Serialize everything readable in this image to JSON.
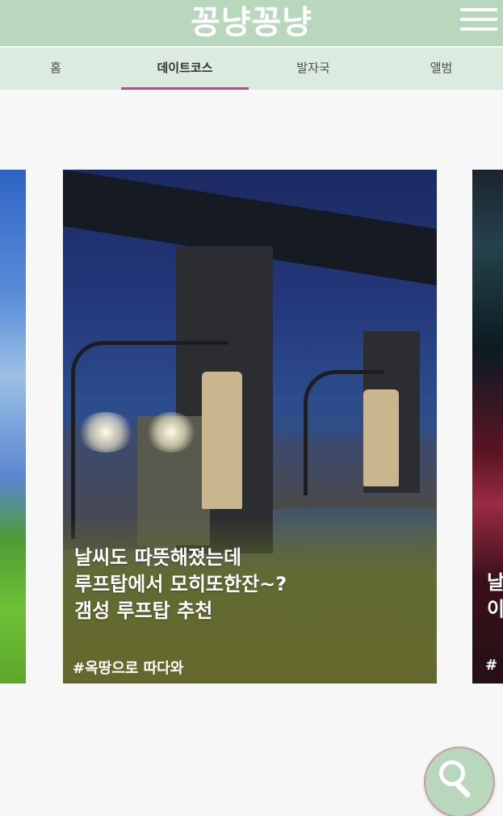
{
  "header": {
    "logo": "꽁냥꽁냥",
    "menu_icon": "hamburger-menu-icon",
    "background": "#b9d7bd"
  },
  "tabs": [
    {
      "label": "홈",
      "active": false
    },
    {
      "label": "데이트코스",
      "active": true
    },
    {
      "label": "발자국",
      "active": false
    },
    {
      "label": "앨범",
      "active": false
    }
  ],
  "accent_color": "#a8577a",
  "carousel": {
    "main_card": {
      "title_lines": [
        "날씨도 따뜻해졌는데",
        "루프탑에서 모히또한잔~?",
        "갬성 루프탑 추천"
      ],
      "tag": "#옥땅으로 따다와"
    },
    "right_card": {
      "title_lines": [
        "날",
        "이"
      ],
      "tag": "#"
    }
  },
  "fab": {
    "icon": "search-icon"
  }
}
